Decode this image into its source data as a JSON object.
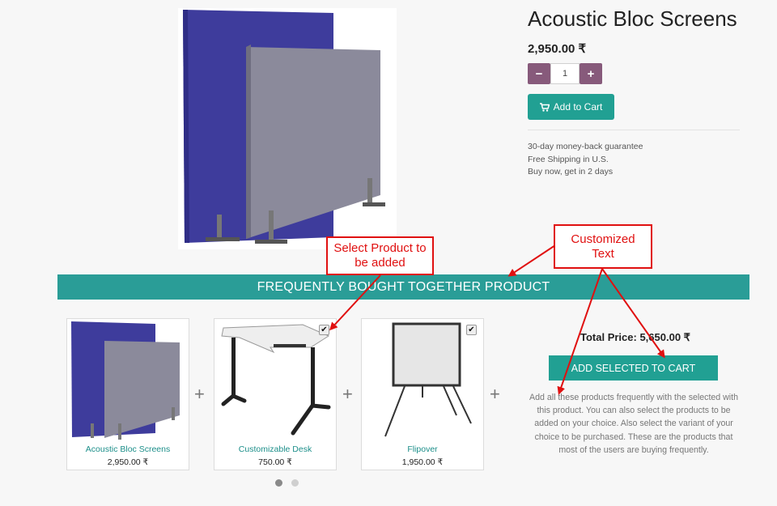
{
  "product": {
    "title": "Acoustic Bloc Screens",
    "price": "2,950.00 ₹",
    "quantity": "1",
    "add_to_cart": "Add to Cart",
    "info": [
      "30-day money-back guarantee",
      "Free Shipping in U.S.",
      "Buy now, get in 2 days"
    ]
  },
  "section": {
    "banner": "FREQUENTLY BOUGHT TOGETHER PRODUCT",
    "products": [
      {
        "name": "Acoustic Bloc Screens",
        "price": "2,950.00 ₹"
      },
      {
        "name": "Customizable Desk",
        "price": "750.00 ₹"
      },
      {
        "name": "Flipover",
        "price": "1,950.00 ₹"
      }
    ],
    "total_price": "Total Price: 5,650.00 ₹",
    "add_selected": "ADD SELECTED TO CART",
    "description": "Add all these products frequently with the selected with this product. You can also select the products to be added on your choice. Also select the variant of your choice to be purchased. These are the products that most of the users are buying frequently."
  },
  "annotations": {
    "select_product": "Select Product to be added",
    "customized_text": "Customized Text"
  },
  "colors": {
    "teal": "#21a093",
    "purple": "#875a7b",
    "annotation_red": "#e01010"
  }
}
